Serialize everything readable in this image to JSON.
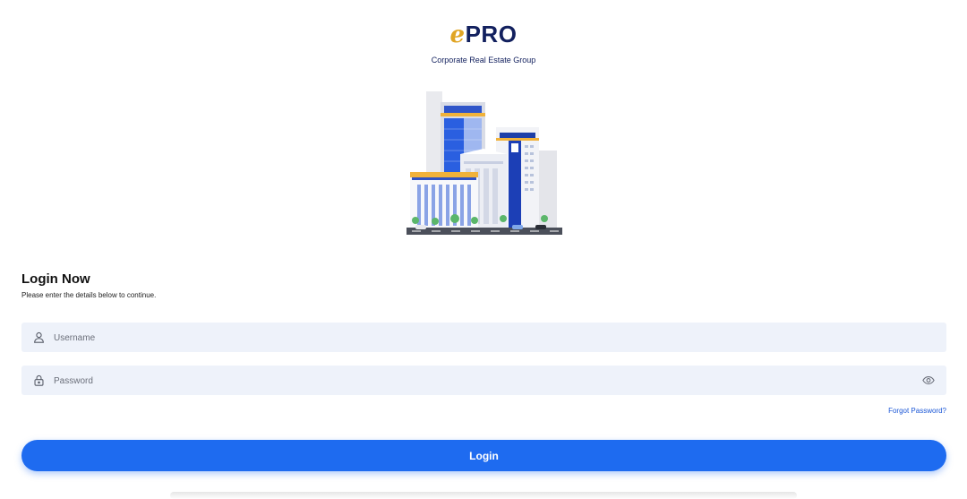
{
  "brand": {
    "logo_e": "e",
    "logo_pro": "PRO",
    "tagline": "Corporate Real Estate Group"
  },
  "login": {
    "title": "Login Now",
    "subtitle": "Please enter the details below to continue.",
    "username_placeholder": "Username",
    "password_placeholder": "Password",
    "forgot_label": "Forgot Password?",
    "button_label": "Login"
  },
  "icons": {
    "username": "user-icon",
    "password": "lock-icon",
    "toggle": "eye-icon"
  },
  "colors": {
    "brand_navy": "#12205e",
    "brand_gold": "#e0a524",
    "primary": "#1e6bf0",
    "field_bg": "#eef2fa"
  }
}
